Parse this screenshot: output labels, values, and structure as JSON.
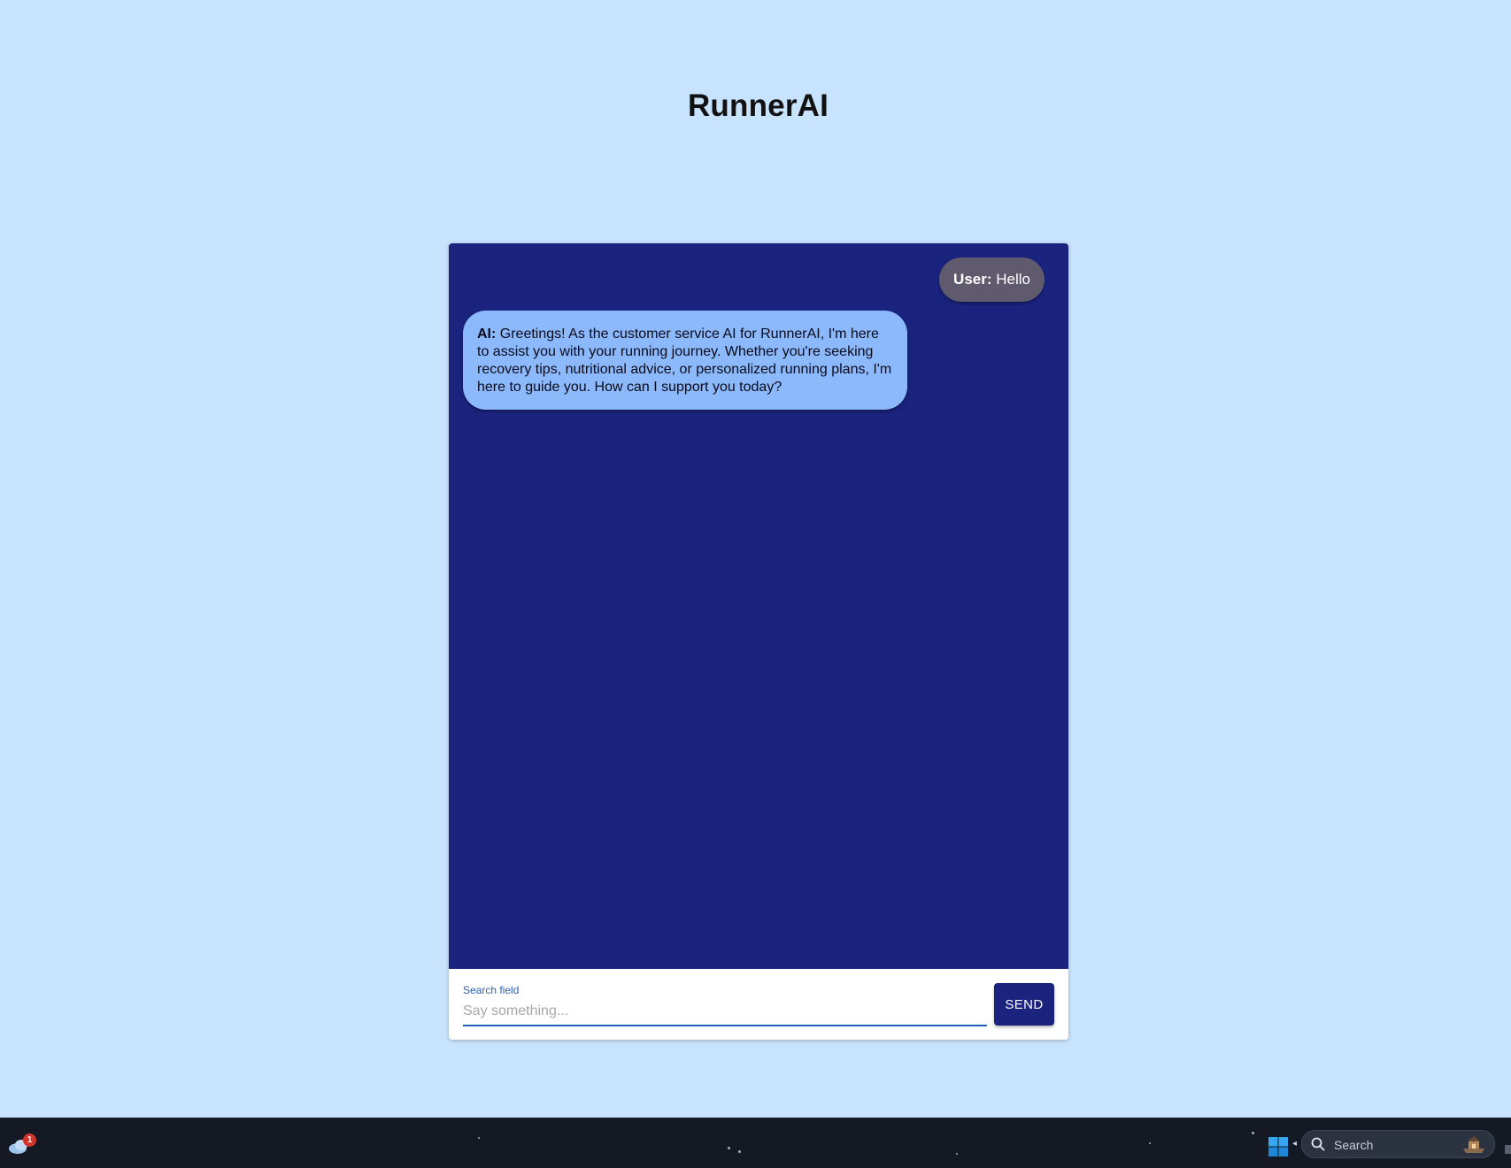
{
  "app": {
    "title": "RunnerAI"
  },
  "chat": {
    "messages": [
      {
        "role": "user",
        "speaker": "User:",
        "text": "Hello"
      },
      {
        "role": "ai",
        "speaker": "AI:",
        "text": "Greetings! As the customer service AI for RunnerAI, I'm here to assist you with your running journey. Whether you're seeking recovery tips, nutritional advice, or personalized running plans, I'm here to guide you. How can I support you today?"
      }
    ],
    "input": {
      "label": "Search field",
      "placeholder": "Say something...",
      "value": ""
    },
    "send_label": "SEND"
  },
  "taskbar": {
    "weather_badge": "1",
    "search_label": "Search",
    "icons": [
      "weather-icon",
      "windows-start-icon",
      "search-icon",
      "search-highlight-icon"
    ]
  },
  "colors": {
    "page_background": "#c8e3fd",
    "chat_background": "#1a237e",
    "user_bubble": "#5f5a6e",
    "ai_bubble": "#8bb9fb",
    "send_button": "#1a237e",
    "input_accent": "#1f5fb8"
  }
}
